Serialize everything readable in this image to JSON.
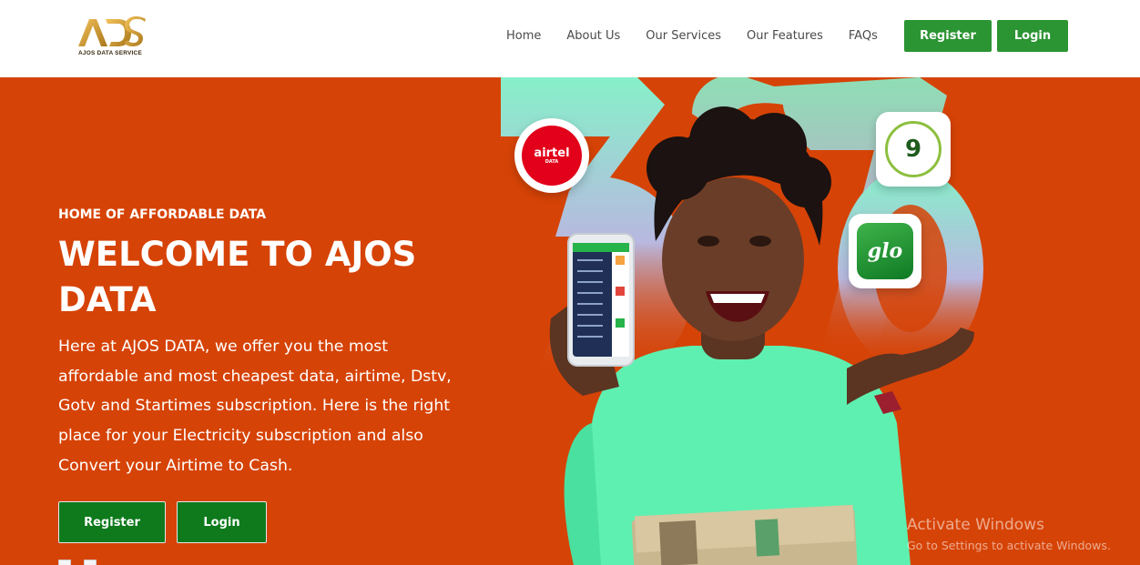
{
  "brand": {
    "logo_text": "AJOS DATA SERVICE",
    "logo_mark": "ADS"
  },
  "nav": {
    "links": [
      "Home",
      "About Us",
      "Our Services",
      "Our Features",
      "FAQs"
    ],
    "register_label": "Register",
    "login_label": "Login"
  },
  "hero": {
    "eyebrow": "HOME OF AFFORDABLE DATA",
    "title": "WELCOME TO AJOS DATA",
    "description": "Here at AJOS DATA, we offer you the most affordable and most cheapest data, airtime, Dstv, Gotv and Startimes subscription. Here is the right place for your Electricity subscription and also Convert your Airtime to Cash.",
    "register_label": "Register",
    "login_label": "Login"
  },
  "badges": {
    "airtel": {
      "name": "airtel",
      "sub": "DATA"
    },
    "nine": {
      "name": "9"
    },
    "glo": {
      "name": "glo"
    }
  },
  "watermark": {
    "title": "Activate Windows",
    "subtitle": "Go to Settings to activate Windows."
  },
  "colors": {
    "hero_bg": "#d64306",
    "accent_green": "#2b9433",
    "hero_button_green": "#0e7a1c",
    "mint": "#7ff2c8"
  }
}
